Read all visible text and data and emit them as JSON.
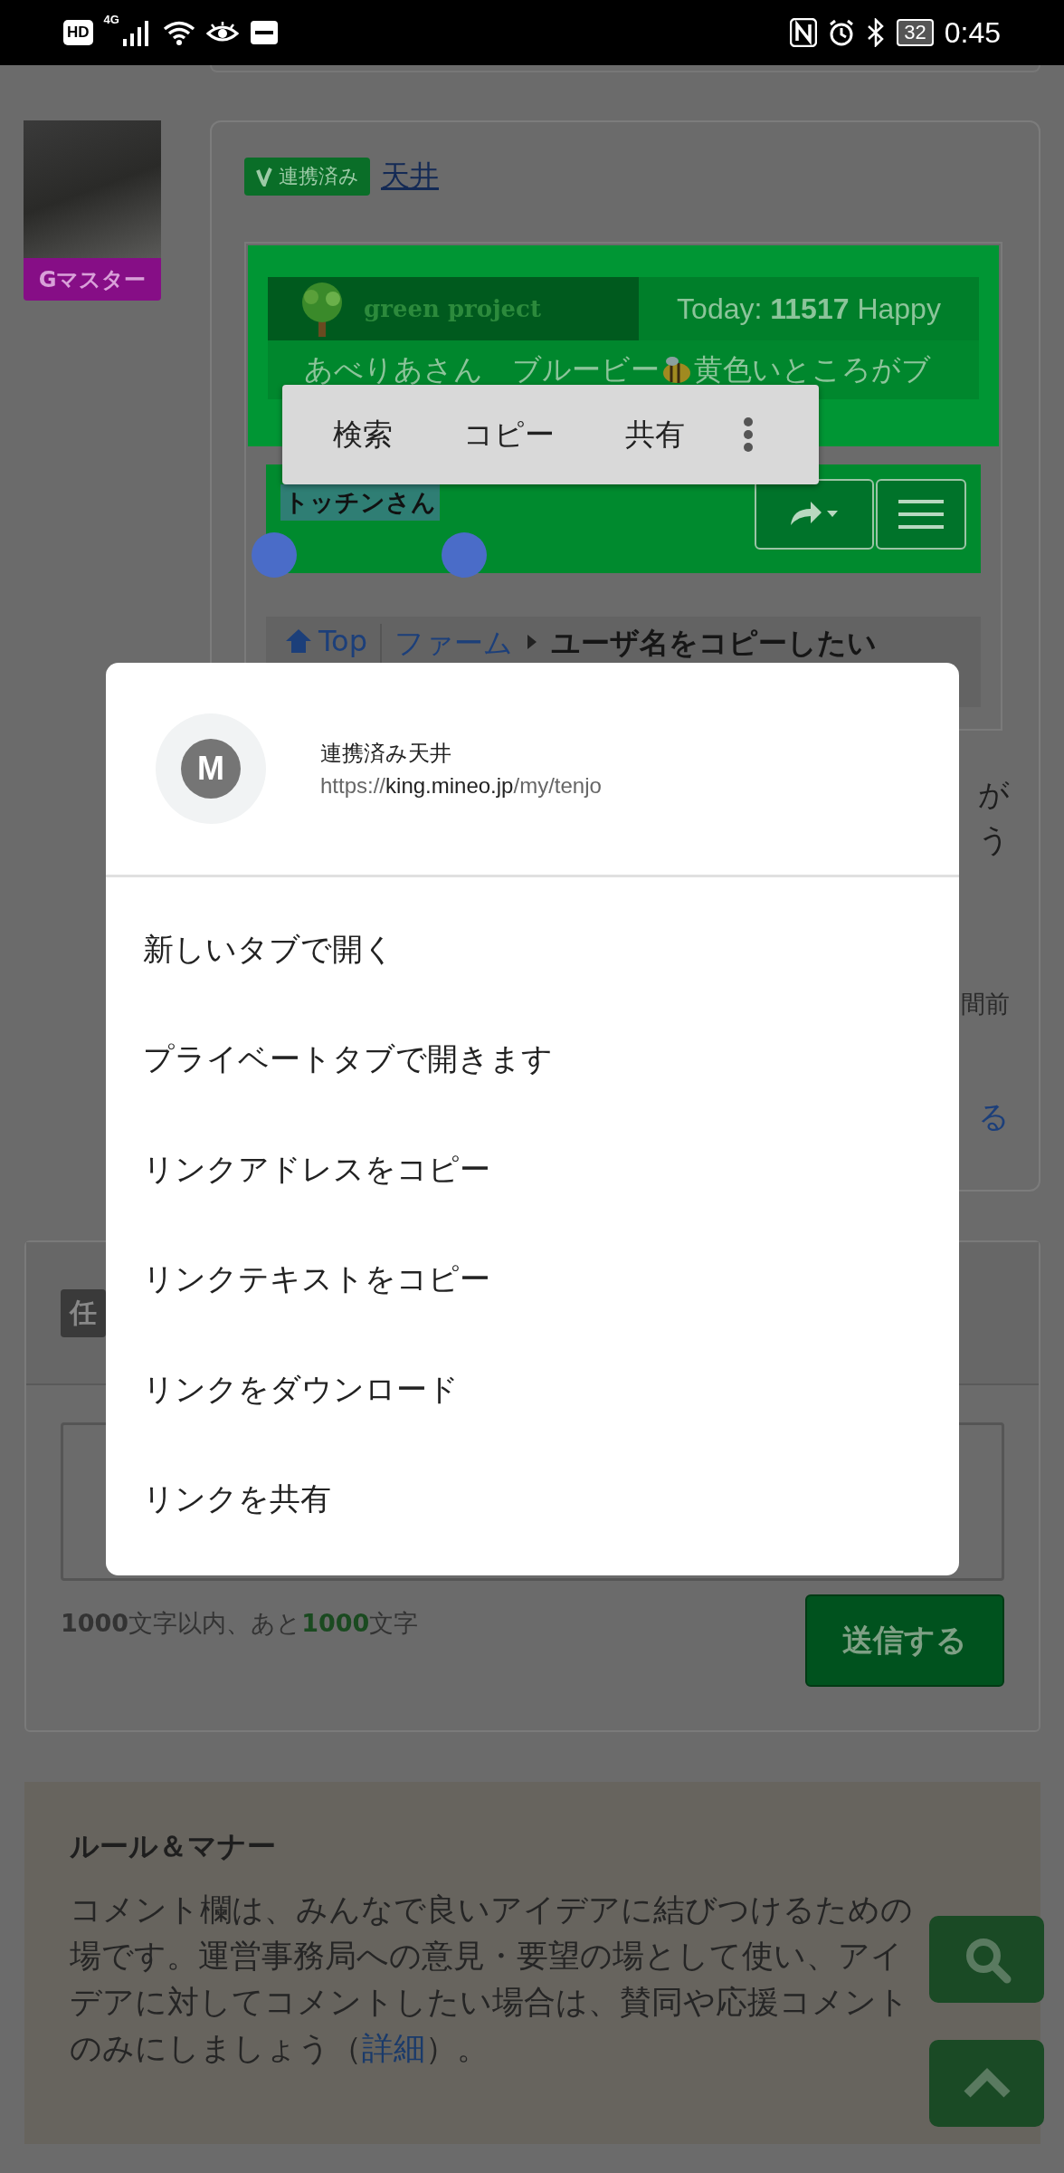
{
  "status_bar": {
    "network_badge": "HD",
    "network_type": "4G",
    "battery": "32",
    "time": "0:45"
  },
  "user": {
    "rank": "Gマスター"
  },
  "post": {
    "badge": "連携済み",
    "author": "天井",
    "embed": {
      "logo_text": "green project",
      "today": "Today: **11517** Happy",
      "ticker_before": "あべりあさん　ブルービー",
      "ticker_after": "黄色いところがブ",
      "user_name": "トッチンさん",
      "user_name_selected": true,
      "breadcrumb": [
        "Top",
        "ファーム",
        "ユーザ名をコピーしたい"
      ]
    },
    "fragments": [
      {
        "kind": "text",
        "text": "が"
      },
      {
        "kind": "text",
        "text": "う"
      },
      {
        "kind": "meta",
        "text": "間前"
      },
      {
        "kind": "link",
        "text": "る"
      }
    ]
  },
  "selection_toolbar": {
    "actions": [
      "検索",
      "コピー",
      "共有"
    ]
  },
  "comment_form": {
    "badge": "任",
    "counter": "**1000**文字以内、あと**1000**文字",
    "submit": "送信する"
  },
  "rules": {
    "title": "ルール＆マナー",
    "body_before": "コメント欄は、みんなで良いアイデアに結びつけるための場です。運営事務局への意見・要望の場として使い、アイデアに対してコメントしたい場合は、賛同や応援コメントのみにしましょう（",
    "link": "詳細",
    "body_after": "）。"
  },
  "context_menu": {
    "avatar_letter": "M",
    "title": "連携済み天井",
    "url": {
      "scheme": "https://",
      "host": "king.mineo.jp",
      "path": "/my/tenjo"
    },
    "items": [
      "新しいタブで開く",
      "プライベートタブで開きます",
      "リンクアドレスをコピー",
      "リンクテキストをコピー",
      "リンクをダウンロード",
      "リンクを共有"
    ]
  }
}
